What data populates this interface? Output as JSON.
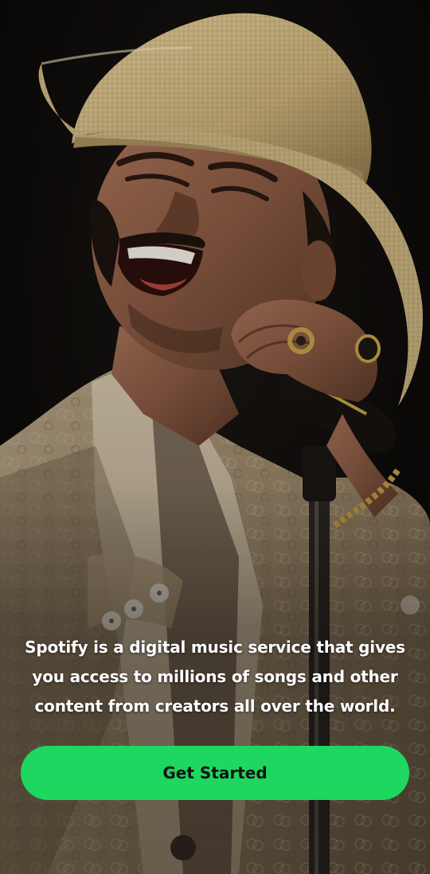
{
  "onboarding": {
    "hero_image": "singer-with-straw-hat-and-microphone",
    "tagline": "Spotify is a digital music service that gives you access to millions of songs and other content from creators all over the world.",
    "cta_label": "Get Started"
  },
  "colors": {
    "accent": "#1ed760",
    "cta_text": "#121212",
    "tagline_text": "#ffffff",
    "background": "#0b0908"
  }
}
